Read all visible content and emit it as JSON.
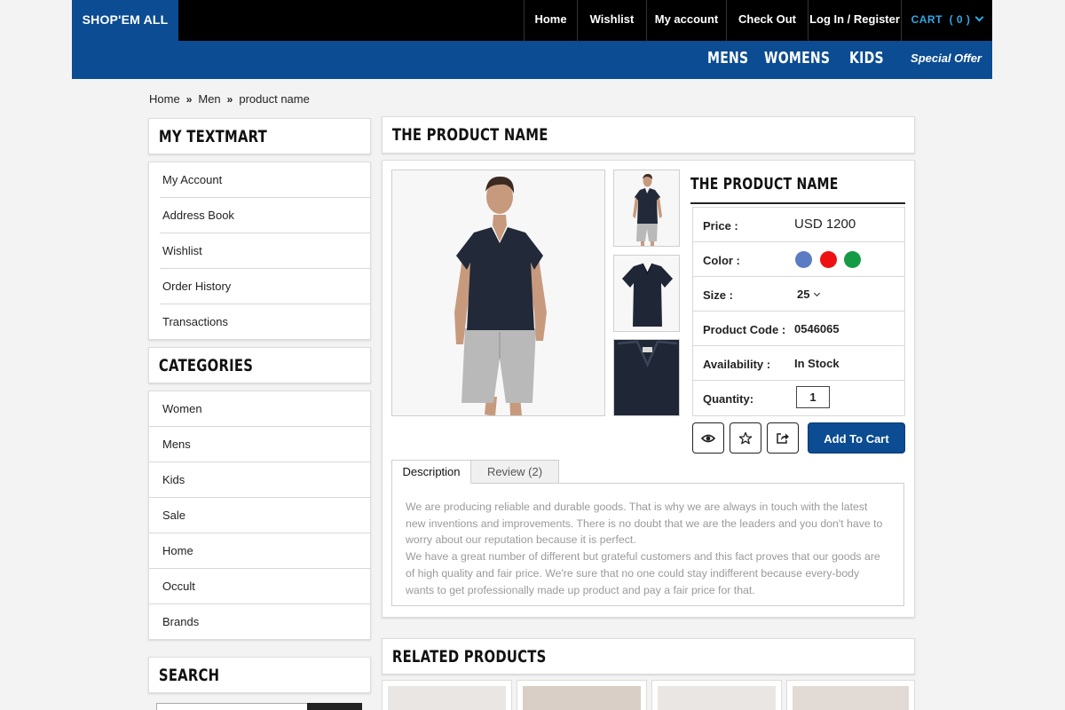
{
  "brand": {
    "logo_text": "SHOP'EM ALL",
    "primary_color": "#0b4c92",
    "link_color": "#2fa8e6"
  },
  "top_nav": {
    "items": [
      "Home",
      "Wishlist",
      "My account",
      "Check Out",
      "Log In / Register"
    ],
    "cart_label": "CART  ( 0 )"
  },
  "category_nav": {
    "items": [
      "MENS",
      "WOMENS",
      "KIDS"
    ],
    "special_offer": "Special Offer"
  },
  "breadcrumb": [
    "Home",
    "Men",
    "product name"
  ],
  "sidebar": {
    "account_title": "MY TEXTMART",
    "account_links": [
      "My Account",
      "Address Book",
      "Wishlist",
      "Order History",
      "Transactions"
    ],
    "categories_title": "CATEGORIES",
    "categories": [
      "Women",
      "Mens",
      "Kids",
      "Sale",
      "Home",
      "Occult",
      "Brands"
    ],
    "search_title": "SEARCH"
  },
  "product": {
    "page_title": "THE PRODUCT NAME",
    "name": "THE PRODUCT NAME",
    "specs": {
      "price_label": "Price :",
      "price": "USD 1200",
      "color_label": "Color :",
      "colors": [
        "#5b7bc2",
        "#ee1111",
        "#169b45"
      ],
      "size_label": "Size :",
      "size": "25",
      "code_label": "Product Code :",
      "code": "0546065",
      "availability_label": "Availability :",
      "availability": "In Stock",
      "quantity_label": "Quantity:",
      "quantity": "1"
    },
    "actions": {
      "view_icon": "eye-icon",
      "wishlist_icon": "star-icon",
      "share_icon": "share-icon",
      "add_to_cart": "Add To Cart"
    },
    "tabs": [
      "Description",
      "Review (2)"
    ],
    "description": [
      "We are producing reliable and durable goods. That is why we are always in touch with the latest new inventions and improvements. There is no doubt that we are the leaders and you don't have to worry about our reputation because it is perfect.",
      "We have a great number of different but grateful customers and this fact proves that our goods are of high quality and fair price. We're sure that no one could stay indifferent because every-body wants to get professionally made up product and pay a fair price for that."
    ]
  },
  "related": {
    "title": "RELATED PRODUCTS"
  }
}
